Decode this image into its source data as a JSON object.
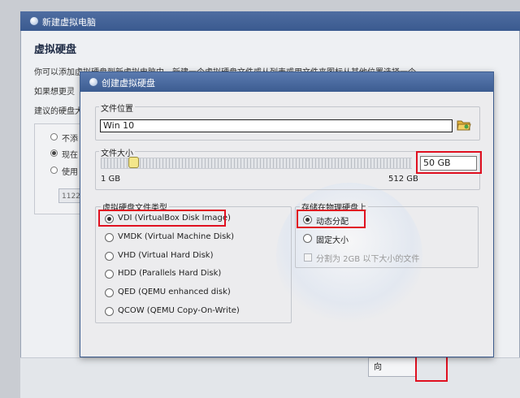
{
  "background_wizard": {
    "title": "新建虚拟电脑",
    "heading": "虚拟硬盘",
    "description_line1": "你可以添加虚拟硬盘到新虚拟电脑中。新建一个虚拟硬盘文件或从列表或用文件夹图标从其他位置选择一个",
    "description_line2": "如果想更灵",
    "description_line3": "建议的硬盘大",
    "options": [
      {
        "label": "不添",
        "selected": false
      },
      {
        "label": "现在",
        "selected": true
      },
      {
        "label": "使用",
        "selected": false
      }
    ],
    "existing_file_value": "1122",
    "next_button": "向"
  },
  "dialog": {
    "title": "创建虚拟硬盘",
    "location": {
      "group_label": "文件位置",
      "value": "Win 10"
    },
    "size": {
      "group_label": "文件大小",
      "min_label": "1 GB",
      "max_label": "512 GB",
      "value": "50 GB",
      "slider_fraction": 0.096
    },
    "file_type": {
      "group_label": "虚拟硬盘文件类型",
      "options": [
        {
          "label": "VDI (VirtualBox Disk Image)",
          "selected": true
        },
        {
          "label": "VMDK (Virtual Machine Disk)",
          "selected": false
        },
        {
          "label": "VHD (Virtual Hard Disk)",
          "selected": false
        },
        {
          "label": "HDD (Parallels Hard Disk)",
          "selected": false
        },
        {
          "label": "QED (QEMU enhanced disk)",
          "selected": false
        },
        {
          "label": "QCOW (QEMU Copy-On-Write)",
          "selected": false
        }
      ]
    },
    "storage": {
      "group_label": "存储在物理硬盘上",
      "options": [
        {
          "label": "动态分配",
          "selected": true
        },
        {
          "label": "固定大小",
          "selected": false
        }
      ],
      "split_checkbox": {
        "label": "分割为 2GB 以下大小的文件",
        "checked": false,
        "enabled": false
      }
    }
  },
  "colors": {
    "highlight": "#e01020",
    "titlebar": "#3c5c91",
    "slider_thumb": "#f3e68a"
  },
  "icons": {
    "folder_button": "folder-open-icon",
    "title_orb": "virtualbox-orb-icon"
  }
}
